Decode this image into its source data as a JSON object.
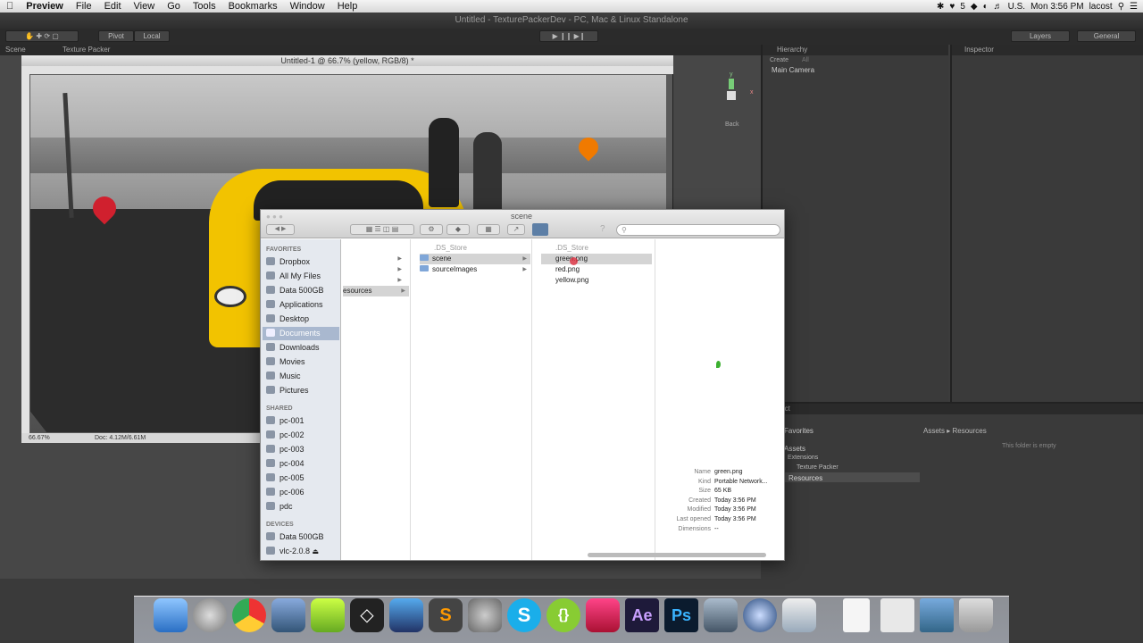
{
  "menubar": {
    "app": "Preview",
    "items": [
      "File",
      "Edit",
      "View",
      "Go",
      "Tools",
      "Bookmarks",
      "Window",
      "Help"
    ],
    "right": {
      "badge": "5",
      "locale": "U.S.",
      "clock": "Mon 3:56 PM",
      "user": "lacost"
    }
  },
  "unity": {
    "window_title": "Untitled - TexturePackerDev - PC, Mac & Linux Standalone",
    "toolbar": {
      "pivot": "Pivot",
      "local": "Local",
      "layers": "Layers",
      "layout": "General"
    },
    "tabs": {
      "scene": "Scene",
      "texture_packer": "Texture Packer",
      "hierarchy": "Hierarchy",
      "inspector": "Inspector",
      "project": "Project"
    },
    "hierarchy": {
      "create": "Create",
      "search": "All",
      "item": "Main Camera"
    },
    "gizmo": {
      "y": "y",
      "x": "x",
      "label": "Back"
    },
    "project": {
      "favorites": "Favorites",
      "assets": "Assets",
      "tree": [
        "Extensions",
        "Texture Packer",
        "Resources"
      ],
      "breadcrumb": "Assets ▸ Resources",
      "empty": "This folder is empty"
    }
  },
  "photoshop": {
    "title": "Untitled-1 @ 66.7% (yellow, RGB/8) *",
    "zoom": "66.67%",
    "doc": "Doc: 4.12M/6.61M"
  },
  "finder": {
    "title": "scene",
    "search_placeholder": "",
    "favorites_label": "FAVORITES",
    "favorites": [
      "Dropbox",
      "All My Files",
      "Data 500GB",
      "Applications",
      "Desktop",
      "Documents",
      "Downloads",
      "Movies",
      "Music",
      "Pictures"
    ],
    "shared_label": "SHARED",
    "shared": [
      "pc-001",
      "pc-002",
      "pc-003",
      "pc-004",
      "pc-005",
      "pc-006",
      "pdc"
    ],
    "devices_label": "DEVICES",
    "devices": [
      "Data 500GB",
      "vlc-2.0.8"
    ],
    "col1": [
      "esources"
    ],
    "col2": [
      ".DS_Store",
      "scene",
      "sourceImages"
    ],
    "col3": [
      ".DS_Store",
      "green.png",
      "red.png",
      "yellow.png"
    ],
    "preview": {
      "labels": [
        "Name",
        "Kind",
        "Size",
        "Created",
        "Modified",
        "Last opened",
        "Dimensions"
      ],
      "values": [
        "green.png",
        "Portable Network...",
        "65 KB",
        "Today 3:56 PM",
        "Today 3:56 PM",
        "Today 3:56 PM",
        "--"
      ]
    }
  },
  "colors": {
    "finder_selection": "#3875d7",
    "unity_bg": "#3c3c3c",
    "car_yellow": "#f2c300",
    "pin_red": "#d0202e",
    "pin_orange": "#f07a00",
    "pin_green": "#3cb030"
  },
  "dock_icons": [
    "finder-icon",
    "launchpad-icon",
    "chrome-icon",
    "xcode-icon",
    "unity-icon",
    "texturepacker-icon",
    "sublime-icon",
    "system-preferences-icon",
    "skype-icon",
    "brackets-icon",
    "dreamweaver-icon",
    "after-effects-icon",
    "photoshop-icon",
    "screen-sharing-icon",
    "quicktime-icon",
    "preview-icon",
    "document-icon",
    "folder-icon",
    "trash-icon"
  ],
  "dock_labels": {
    "ae": "Ae",
    "ps": "Ps",
    "skype": "S",
    "brackets": "{}"
  }
}
